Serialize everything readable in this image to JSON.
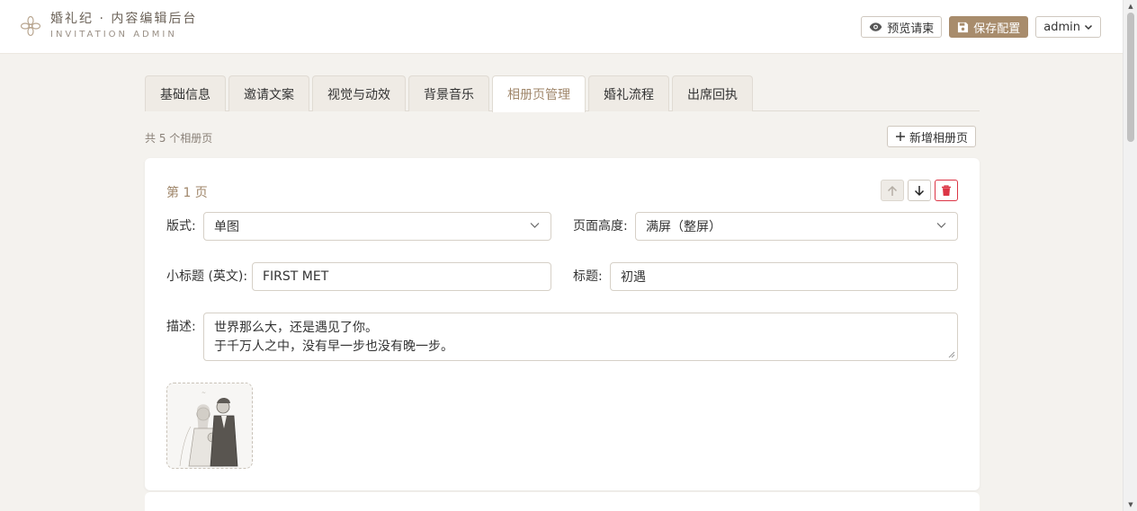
{
  "header": {
    "title": "婚礼纪 · 内容编辑后台",
    "subtitle": "INVITATION ADMIN",
    "preview_label": "预览请柬",
    "save_label": "保存配置",
    "user_label": "admin"
  },
  "tabs": [
    {
      "label": "基础信息"
    },
    {
      "label": "邀请文案"
    },
    {
      "label": "视觉与动效"
    },
    {
      "label": "背景音乐"
    },
    {
      "label": "相册页管理",
      "active": true
    },
    {
      "label": "婚礼流程"
    },
    {
      "label": "出席回执"
    }
  ],
  "album": {
    "count_text": "共 5 个相册页",
    "add_label": "新增相册页",
    "page": {
      "label": "第 1 页",
      "layout_label": "版式:",
      "layout_value": "单图",
      "height_label": "页面高度:",
      "height_value": "满屏（整屏）",
      "subtitle_label": "小标题 (英文):",
      "subtitle_value": "FIRST MET",
      "title_label": "标题:",
      "title_value": "初遇",
      "desc_label": "描述:",
      "desc_line1": "世界那么大，还是遇见了你。",
      "desc_line2": "于千万人之中，没有早一步也没有晚一步。"
    }
  },
  "colors": {
    "accent": "#a88c6c",
    "danger": "#dc3545",
    "background": "#f4f2ee"
  },
  "icons": [
    "flower-logo-icon",
    "eye-icon",
    "save-icon",
    "chevron-down-icon",
    "plus-icon",
    "arrow-up-icon",
    "arrow-down-icon",
    "trash-icon"
  ]
}
